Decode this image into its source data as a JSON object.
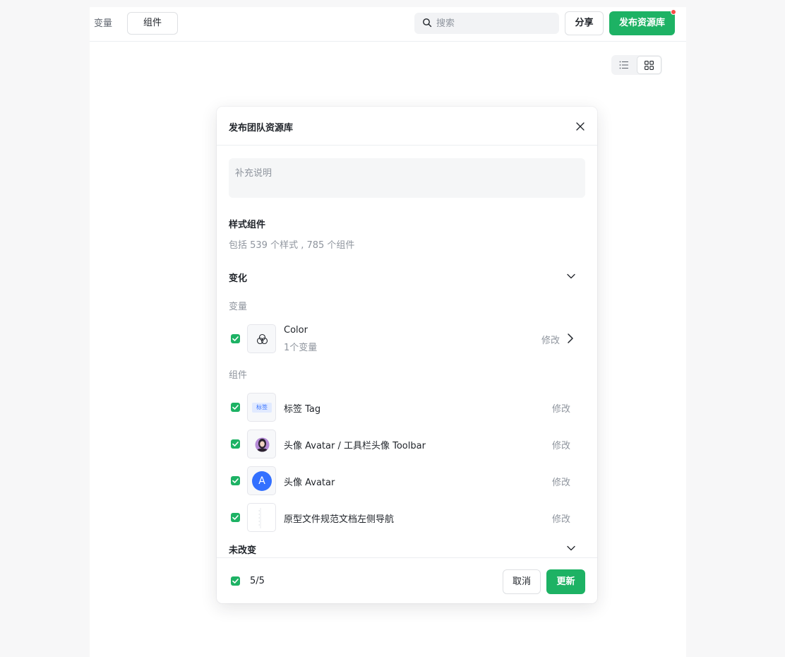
{
  "topbar": {
    "tab_variables": "变量",
    "tab_components": "组件",
    "search_placeholder": "搜索",
    "share_label": "分享",
    "publish_label": "发布资源库"
  },
  "modal": {
    "title": "发布团队资源库",
    "note_placeholder": "补充说明",
    "styles_section": {
      "title": "样式组件",
      "summary": "包括 539 个样式 , 785 个组件"
    },
    "changed_section": {
      "title": "变化",
      "variables_label": "变量",
      "variables": [
        {
          "name": "Color",
          "sub": "1个变量",
          "action": "修改",
          "checked": true
        }
      ],
      "components_label": "组件",
      "components": [
        {
          "name": "标签 Tag",
          "action": "修改",
          "checked": true,
          "thumb_text": "标签"
        },
        {
          "name": "头像 Avatar / 工具栏头像 Toolbar",
          "action": "修改",
          "checked": true
        },
        {
          "name": "头像 Avatar",
          "action": "修改",
          "checked": true,
          "thumb_text": "A"
        },
        {
          "name": "原型文件规范文档左侧导航",
          "action": "修改",
          "checked": true
        }
      ]
    },
    "unchanged_section": {
      "title": "未改变"
    },
    "footer": {
      "count": "5/5",
      "cancel_label": "取消",
      "update_label": "更新"
    }
  },
  "colors": {
    "accent": "#1db264",
    "notify": "#f54a45",
    "avatar_blue": "#3370ff"
  }
}
